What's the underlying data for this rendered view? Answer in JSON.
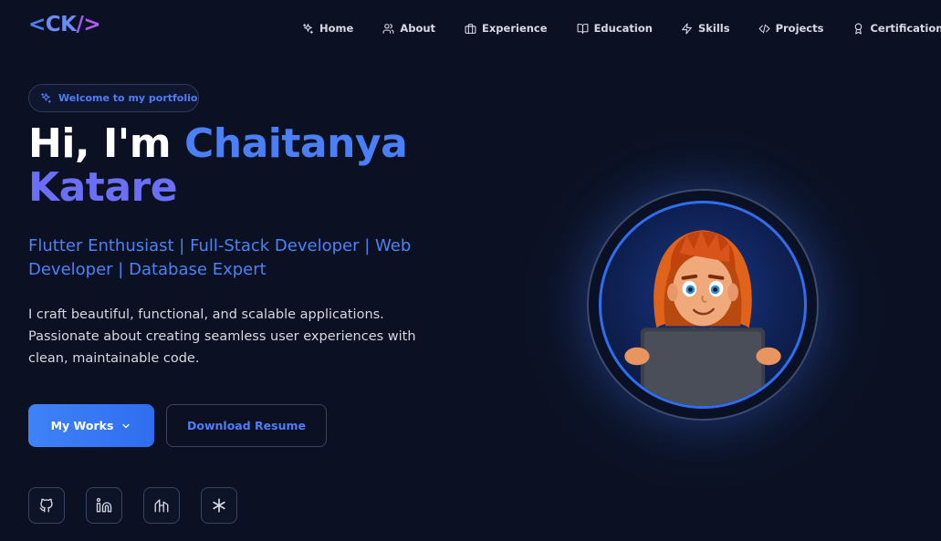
{
  "logo": {
    "text_bracket_left": "<",
    "text_initials": "CK",
    "text_slash": "/",
    "text_bracket_right": ">"
  },
  "nav": [
    {
      "label": "Home",
      "icon": "sparkles-icon"
    },
    {
      "label": "About",
      "icon": "users-icon"
    },
    {
      "label": "Experience",
      "icon": "briefcase-icon"
    },
    {
      "label": "Education",
      "icon": "book-open-icon"
    },
    {
      "label": "Skills",
      "icon": "zap-icon"
    },
    {
      "label": "Projects",
      "icon": "code-icon"
    },
    {
      "label": "Certifications",
      "icon": "award-icon"
    }
  ],
  "hero": {
    "badge": "Welcome to my portfolio",
    "greeting": "Hi, I'm ",
    "first_name": "Chaitanya",
    "last_name": "Katare",
    "subtitle": "Flutter Enthusiast | Full-Stack Developer | Web Developer | Database Expert",
    "description": "I craft beautiful, functional, and scalable applications. Passionate about creating seamless user experiences with clean, maintainable code.",
    "primary_button": "My Works",
    "secondary_button": "Download Resume"
  },
  "socials": [
    {
      "name": "GitHub",
      "icon": "github-icon"
    },
    {
      "name": "LinkedIn",
      "icon": "linkedin-icon"
    },
    {
      "name": "Hashnode",
      "icon": "hashnode-icon"
    },
    {
      "name": "Asterisk",
      "icon": "asterisk-icon"
    }
  ],
  "colors": {
    "background": "#0b1122",
    "accent_blue": "#4a7ff5",
    "accent_purple": "#6a6ff5",
    "button_primary": "#3f82f6"
  }
}
